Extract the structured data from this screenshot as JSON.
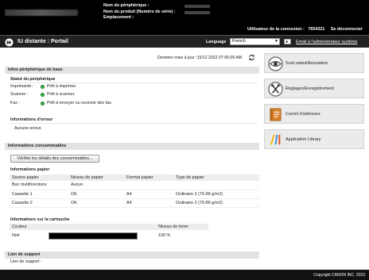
{
  "header": {
    "device_name_label": "Nom du périphérique :",
    "product_name_label": "Nom du produit (Numéro de série) :",
    "location_label": "Emplacement :",
    "login_label": "Utilisateur de la connexion :",
    "login_user": "7654321",
    "logout": "Se déconnecter"
  },
  "titlebar": {
    "title": "IU distante : Portail",
    "language_label": "Language",
    "language_value": "French",
    "email_admin": "Email à l'administrateur système"
  },
  "updated": "Dernière mise à jour :15/12 2022 07:06:09 AM",
  "basic_info": {
    "header": "Infos périphérique de base",
    "status_title": "Statut du périphérique",
    "printer_label": "Imprimante :",
    "printer_status": "Prêt à imprimer.",
    "scanner_label": "Scanner :",
    "scanner_status": "Prêt à scanner.",
    "fax_label": "Fax :",
    "fax_status": "Prêt à envoyer ou recevoir des fax.",
    "error_title": "Informations d'erreur",
    "error_value": "Aucune erreur."
  },
  "consumables": {
    "header": "Informations consommables",
    "check_button": "Vérifier les détails des consommables...",
    "paper_title": "Informations papier",
    "paper_columns": [
      "Source papier",
      "Niveau de papier",
      "Format papier",
      "Type de papier"
    ],
    "paper_rows": [
      [
        "Bac multifonctions",
        "Aucun",
        "",
        ""
      ],
      [
        "Cassette 1",
        "OK",
        "A4",
        "Ordinaire 2 (75-89 g/m2)"
      ],
      [
        "Cassette 2",
        "OK",
        "A4",
        "Ordinaire 2 (75-89 g/m2)"
      ]
    ],
    "cartridge_title": "Informations sur la cartouche",
    "toner_columns": [
      "Couleur",
      "",
      "Niveau de toner"
    ],
    "toner_color": "Noir",
    "toner_level": "100 %",
    "toner_fraction": 1.0
  },
  "support": {
    "header": "Lien de support",
    "label": "Lien de support :"
  },
  "right_panel": [
    {
      "label": "Suivi statut/Annulation",
      "icon": "status-monitor-icon"
    },
    {
      "label": "Réglages/Enregistrement",
      "icon": "settings-icon"
    },
    {
      "label": "Carnet d'adresses",
      "icon": "address-book-icon"
    },
    {
      "label": "Application Library",
      "icon": "application-library-icon"
    }
  ],
  "footer": {
    "copyright": "Copyright CANON INC. 2023"
  },
  "colors": {
    "ready_dot": "#3cb44b",
    "header_bg": "#000000",
    "section_bg": "#e2e2e2"
  }
}
